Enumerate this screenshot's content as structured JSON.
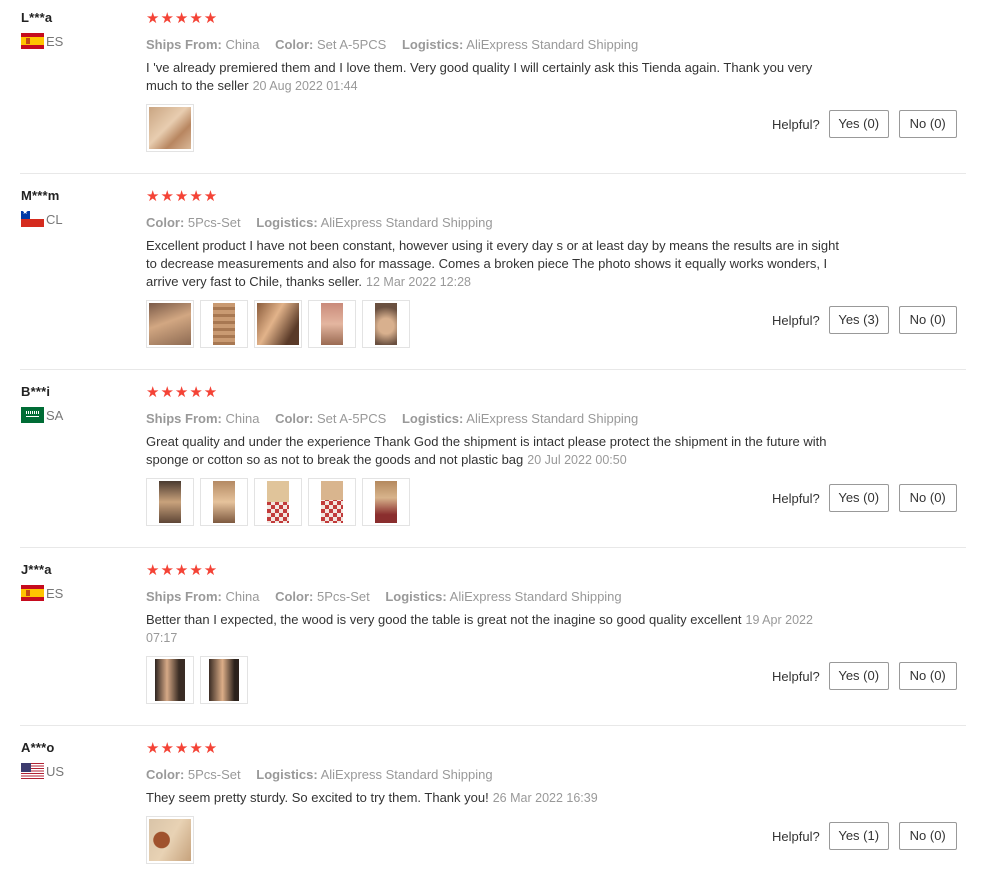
{
  "labels": {
    "ships_from": "Ships From:",
    "color": "Color:",
    "logistics": "Logistics:",
    "helpful": "Helpful?"
  },
  "reviews": [
    {
      "user": "L***a",
      "country": "ES",
      "rating": 5,
      "stars": "★★★★★",
      "ships_from": "China",
      "color": "Set A-5PCS",
      "logistics": "AliExpress Standard Shipping",
      "text": "I 've already premiered them and I love them. Very good quality I will certainly ask this Tienda again. Thank you very much to the seller",
      "date": "20 Aug 2022 01:44",
      "photo_count": 1,
      "yes": "Yes (0)",
      "no": "No (0)"
    },
    {
      "user": "M***m",
      "country": "CL",
      "rating": 5,
      "stars": "★★★★★",
      "color": "5Pcs-Set",
      "logistics": "AliExpress Standard Shipping",
      "text": "Excellent product I have not been constant, however using it every day s or at least day by means the results are in sight to decrease measurements and also for massage. Comes a broken piece The photo shows it equally works wonders, I arrive very fast to Chile, thanks seller.",
      "date": "12 Mar 2022 12:28",
      "photo_count": 5,
      "yes": "Yes (3)",
      "no": "No (0)"
    },
    {
      "user": "B***i",
      "country": "SA",
      "rating": 5,
      "stars": "★★★★★",
      "ships_from": "China",
      "color": "Set A-5PCS",
      "logistics": "AliExpress Standard Shipping",
      "text": "Great quality and under the experience Thank God the shipment is intact please protect the shipment in the future with sponge or cotton so as not to break the goods and not plastic bag",
      "date": "20 Jul 2022 00:50",
      "photo_count": 5,
      "yes": "Yes (0)",
      "no": "No (0)"
    },
    {
      "user": "J***a",
      "country": "ES",
      "rating": 5,
      "stars": "★★★★★",
      "ships_from": "China",
      "color": "5Pcs-Set",
      "logistics": "AliExpress Standard Shipping",
      "text": "Better than I expected, the wood is very good the table is great not the inagine so good quality excellent",
      "date": "19 Apr 2022 07:17",
      "photo_count": 2,
      "yes": "Yes (0)",
      "no": "No (0)"
    },
    {
      "user": "A***o",
      "country": "US",
      "rating": 5,
      "stars": "★★★★★",
      "color": "5Pcs-Set",
      "logistics": "AliExpress Standard Shipping",
      "text": "They seem pretty sturdy. So excited to try them. Thank you!",
      "date": "26 Mar 2022 16:39",
      "photo_count": 1,
      "yes": "Yes (1)",
      "no": "No (0)"
    }
  ]
}
